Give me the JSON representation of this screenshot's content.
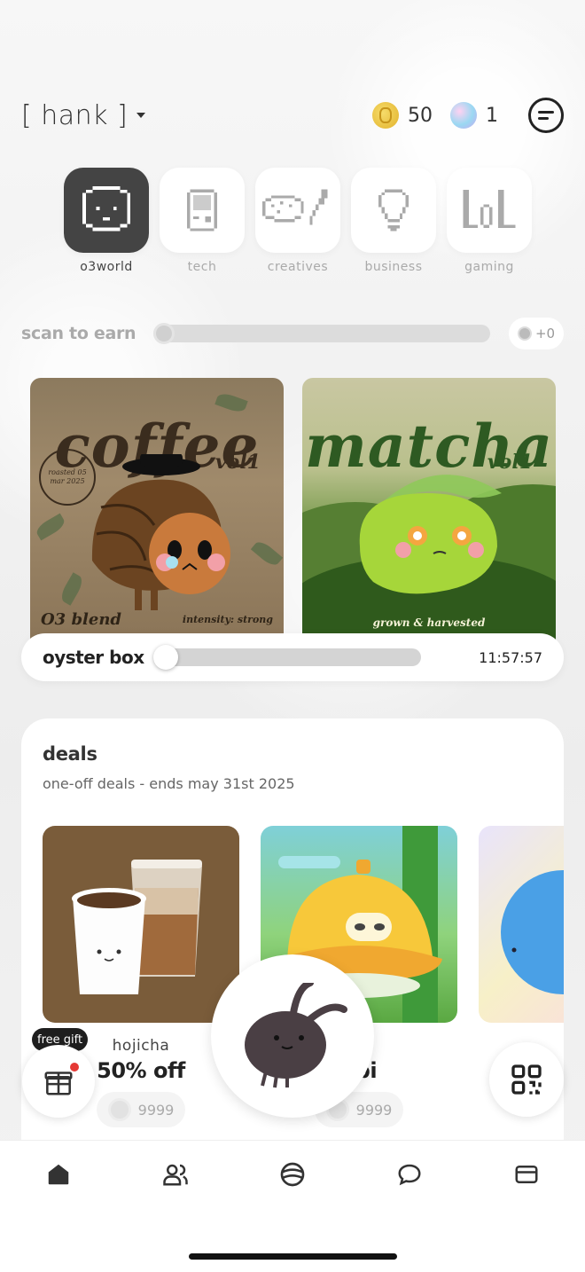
{
  "header": {
    "username": "[ hank ]",
    "coins": "50",
    "gems": "1"
  },
  "categories": [
    {
      "label": "o3world",
      "icon": "smiley-face-icon",
      "active": true
    },
    {
      "label": "tech",
      "icon": "handheld-device-icon",
      "active": false
    },
    {
      "label": "creatives",
      "icon": "palette-brush-icon",
      "active": false
    },
    {
      "label": "business",
      "icon": "lightbulb-icon",
      "active": false
    },
    {
      "label": "gaming",
      "icon": "lol-logo-icon",
      "active": false
    }
  ],
  "scan": {
    "label": "scan to earn",
    "earned": "+0",
    "progress": 0
  },
  "boxes": {
    "coffee": {
      "title": "coffee",
      "vol": "vol1",
      "stamp": "roasted 05 mar 2025",
      "footer_left": "O3 blend",
      "footer_right": "intensity: strong"
    },
    "matcha": {
      "title": "matcha",
      "vol": "vol1",
      "footer": "grown & harvested"
    }
  },
  "oyster": {
    "label": "oyster box",
    "timer": "11:57:57",
    "progress": 0
  },
  "deals": {
    "title": "deals",
    "subtitle": "one-off deals - ends may 31st 2025",
    "items": [
      {
        "name": "hojicha",
        "offer": "50% off",
        "price": "9999"
      },
      {
        "name": "ure",
        "offer": "abi",
        "price": "9999"
      }
    ]
  },
  "floating": {
    "gift_tag": "free gift"
  },
  "colors": {
    "accent_dark": "#444444",
    "notification_dot": "#e53935",
    "coin_gold": "#e2b22c"
  }
}
